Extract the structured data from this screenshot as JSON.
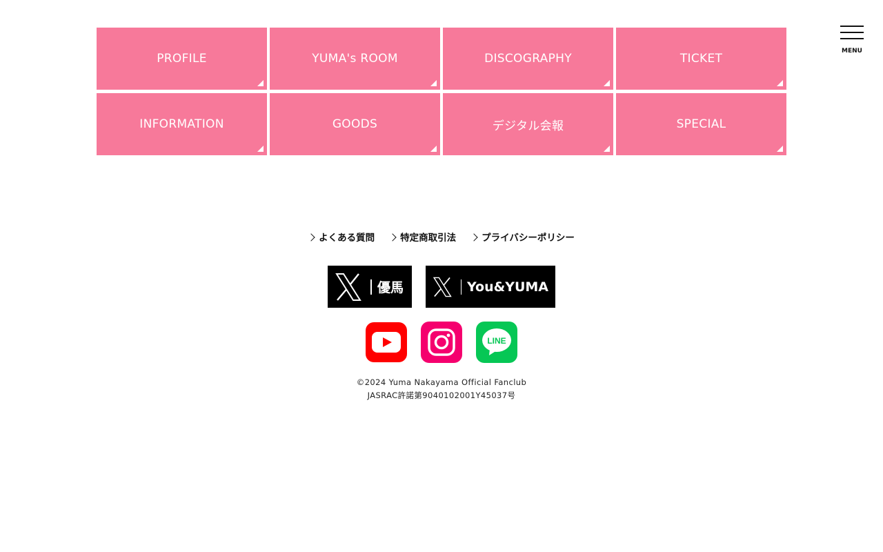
{
  "nav": {
    "tile_color": "#f7799a",
    "items": [
      {
        "label": "PROFILE"
      },
      {
        "label": "YUMA's ROOM"
      },
      {
        "label": "DISCOGRAPHY"
      },
      {
        "label": "TICKET"
      },
      {
        "label": "INFORMATION"
      },
      {
        "label": "GOODS"
      },
      {
        "label": "デジタル会報"
      },
      {
        "label": "SPECIAL"
      }
    ]
  },
  "header": {
    "menu_label": "MENU",
    "menu_icon": "hamburger-icon"
  },
  "footer_links": [
    {
      "label": "よくある質問",
      "icon": "chevron-right-icon"
    },
    {
      "label": "特定商取引法",
      "icon": "chevron-right-icon"
    },
    {
      "label": "プライバシーポリシー",
      "icon": "chevron-right-icon"
    }
  ],
  "x_accounts": [
    {
      "name": "優馬",
      "icon": "x-logo-icon"
    },
    {
      "name": "You&YUMA",
      "icon": "x-logo-icon"
    }
  ],
  "social": [
    {
      "icon": "youtube-icon",
      "color": "#ff0000"
    },
    {
      "icon": "instagram-icon",
      "color": "#f5006e"
    },
    {
      "icon": "line-icon",
      "color": "#06c755",
      "label": "LINE"
    }
  ],
  "copyright": {
    "line1": "©2024 Yuma Nakayama Official Fanclub",
    "line2": "JASRAC許諾第9040102001Y45037号"
  }
}
